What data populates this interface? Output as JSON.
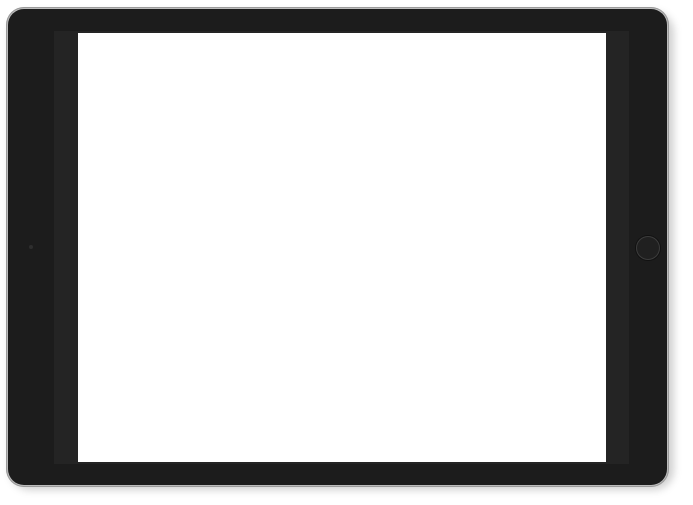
{
  "device": {
    "type": "tablet",
    "orientation": "landscape",
    "bezel_color": "#1c1c1c",
    "frame_color": "#bcbcbc",
    "screen_color": "#ffffff"
  },
  "icons": {
    "home_button": "home-button-icon",
    "camera": "camera-icon"
  }
}
